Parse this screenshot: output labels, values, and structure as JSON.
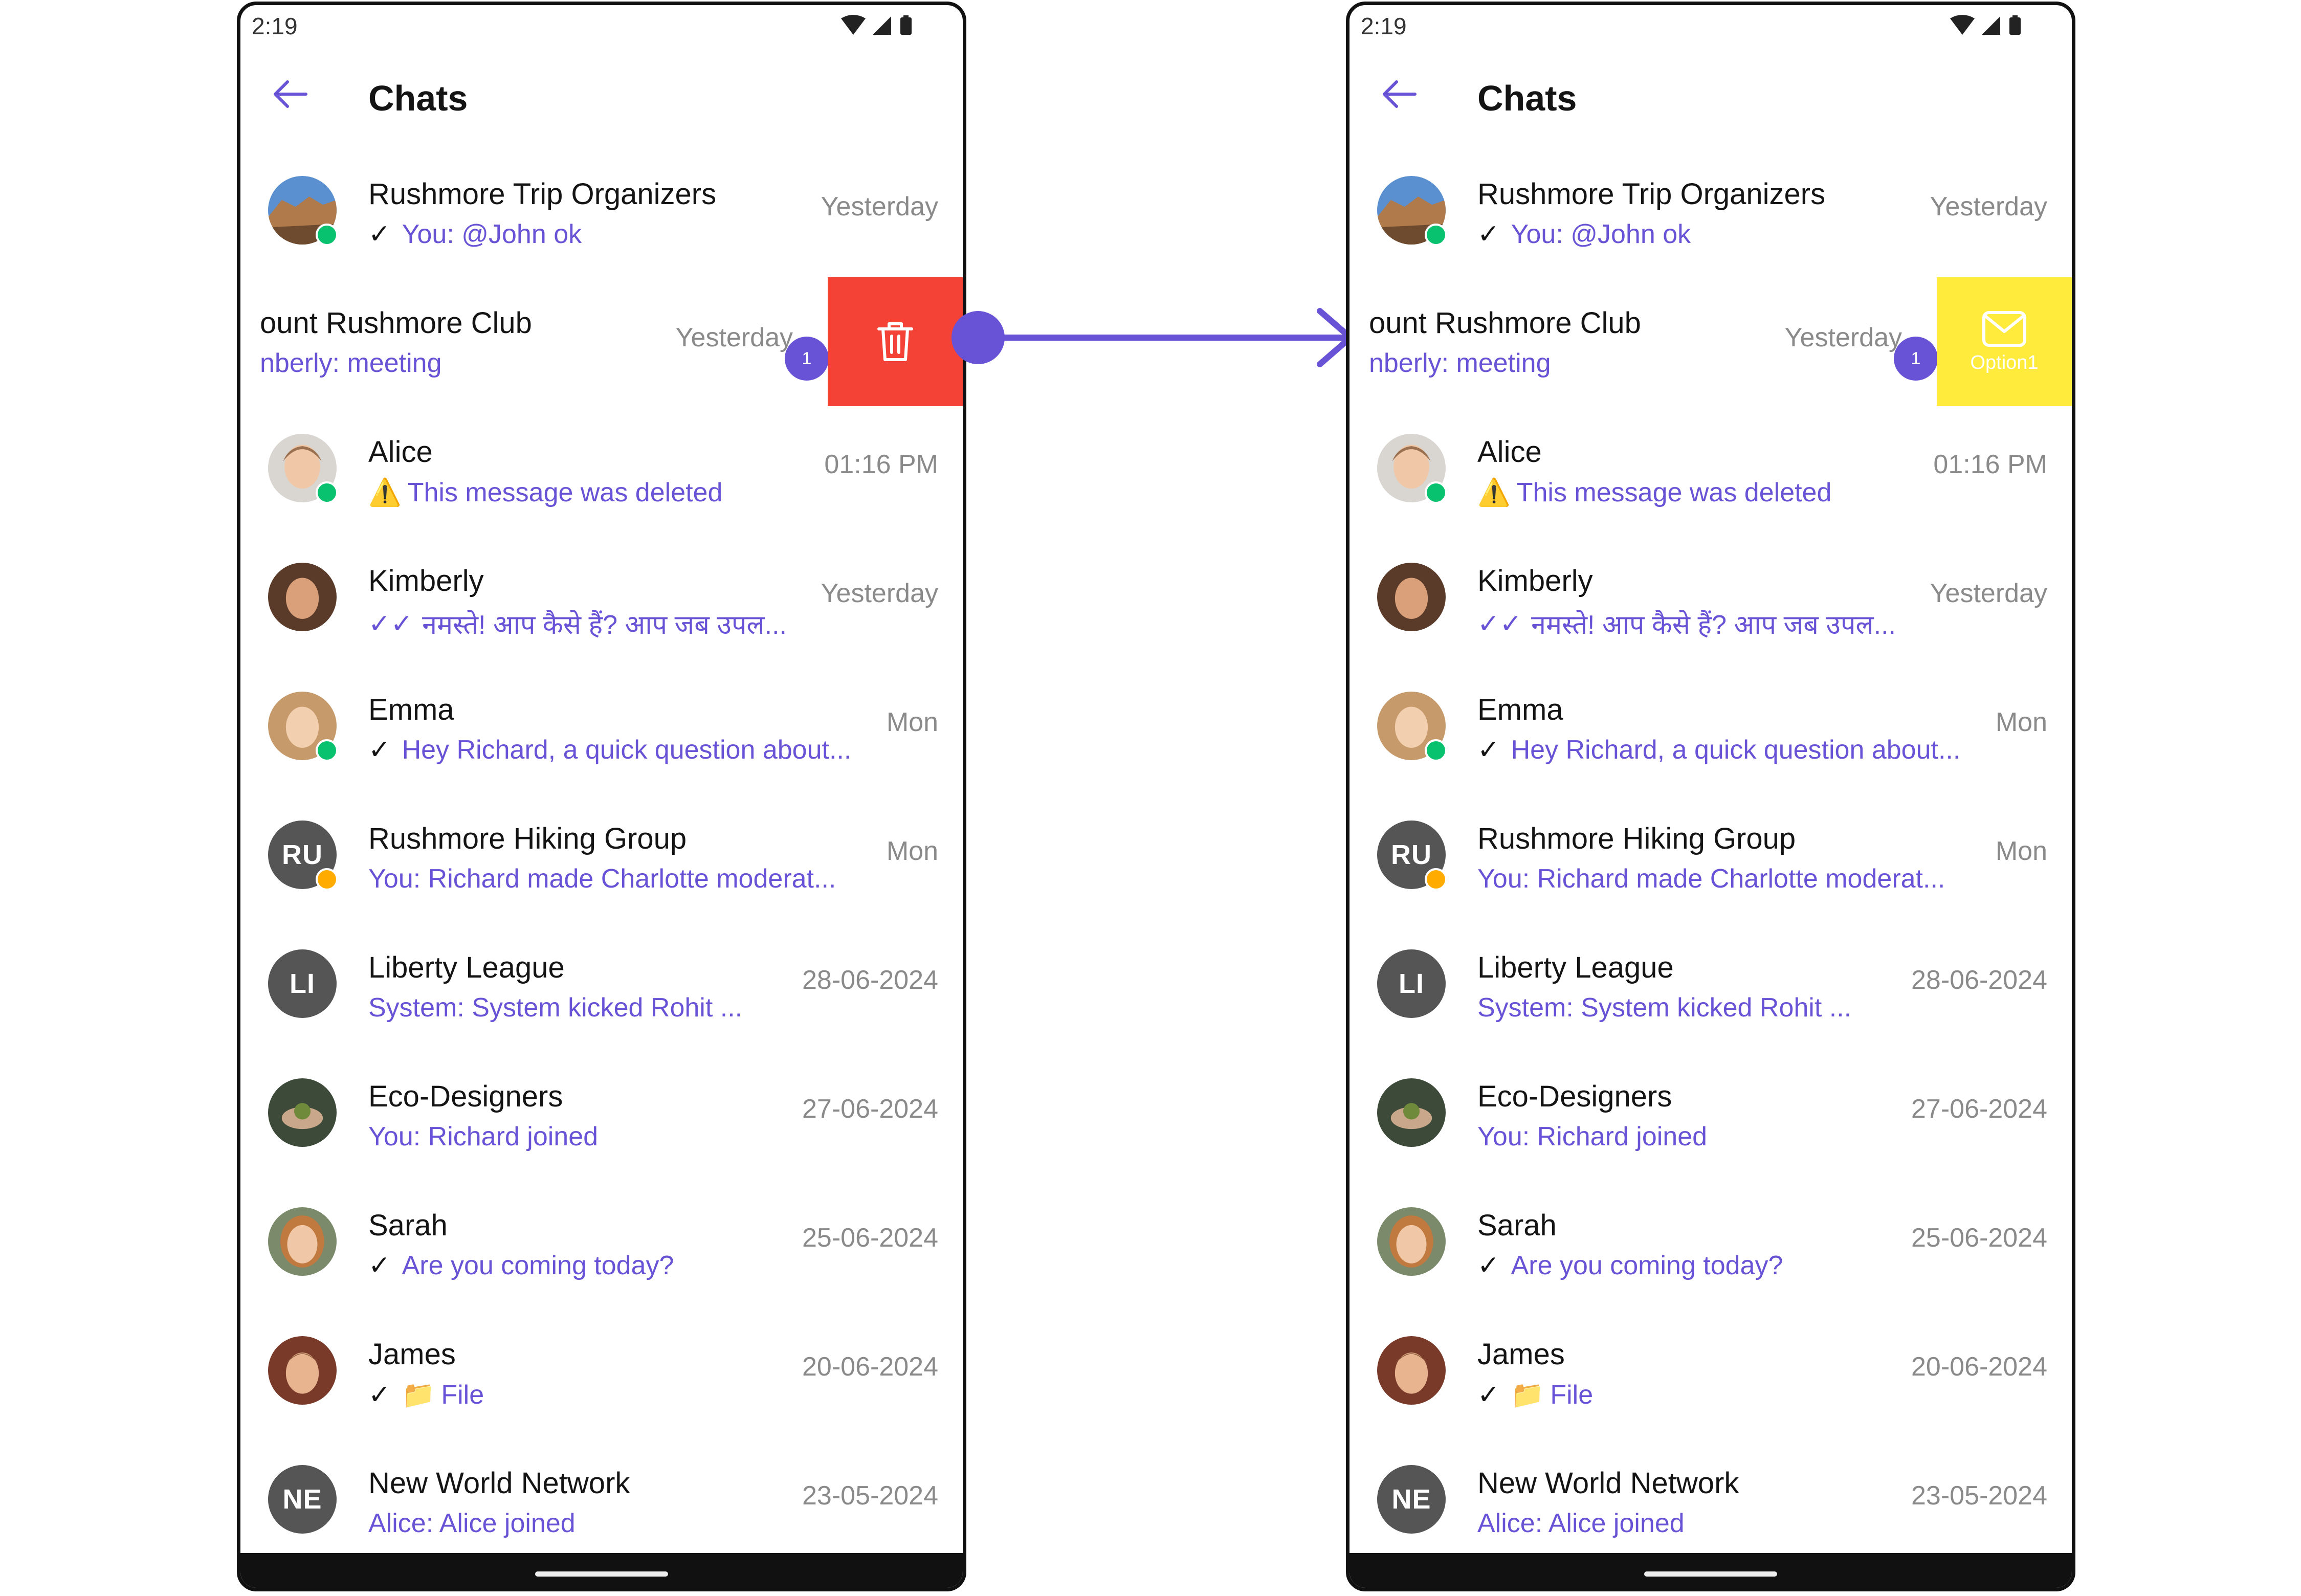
{
  "colors": {
    "accent": "#6852d6",
    "text_primary": "#141414",
    "text_secondary": "#8a8a8a",
    "online": "#09c26f",
    "delete_action": "#f44336",
    "option_action": "#ffeb3b",
    "initials_avatar": "#555555"
  },
  "status_bar": {
    "time": "2:19"
  },
  "app_bar": {
    "title": "Chats",
    "back_icon": "arrow-left-icon"
  },
  "chats": [
    {
      "name": "Rushmore Trip Organizers",
      "receipt": "✓",
      "preview": "You: @John ok",
      "date": "Yesterday",
      "avatar": "image",
      "status": "online"
    },
    {
      "name": "ount Rushmore Club",
      "preview": "nberly: meeting",
      "date": "Yesterday",
      "unread": "1",
      "swiped": true
    },
    {
      "name": "Alice",
      "warning": "⚠️",
      "preview": "This message was deleted",
      "date": "01:16 PM",
      "avatar": "image",
      "status": "online"
    },
    {
      "name": "Kimberly",
      "receipt": "✓✓",
      "preview": "नमस्ते! आप कैसे हैं?  आप जब उपल...",
      "date": "Yesterday",
      "avatar": "image"
    },
    {
      "name": "Emma",
      "receipt": "✓",
      "preview": "Hey Richard, a quick question about...",
      "date": "Mon",
      "avatar": "image",
      "status": "online"
    },
    {
      "name": "Rushmore Hiking Group",
      "preview": "You: Richard made Charlotte moderat...",
      "date": "Mon",
      "initials": "RU",
      "status": "private"
    },
    {
      "name": "Liberty League",
      "preview": "System: System kicked Rohit ...",
      "date": "28-06-2024",
      "initials": "LI"
    },
    {
      "name": "Eco-Designers",
      "preview": "You: Richard joined",
      "date": "27-06-2024",
      "avatar": "image"
    },
    {
      "name": "Sarah",
      "receipt": "✓",
      "preview": "Are you coming today?",
      "date": "25-06-2024",
      "avatar": "image"
    },
    {
      "name": "James",
      "receipt": "✓",
      "folder": "📁",
      "preview": "File",
      "date": "20-06-2024",
      "avatar": "image"
    },
    {
      "name": "New World Network",
      "preview": "Alice: Alice joined",
      "date": "23-05-2024",
      "initials": "NE"
    }
  ],
  "swipe_actions": {
    "left": {
      "type": "delete",
      "icon": "trash-icon"
    },
    "right": {
      "type": "option",
      "icon": "mail-icon",
      "label": "Option1"
    }
  }
}
